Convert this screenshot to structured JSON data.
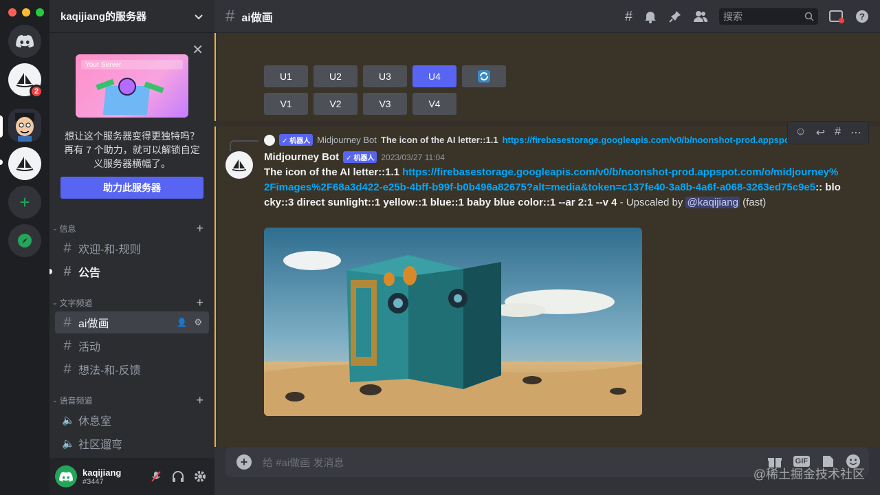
{
  "window": {
    "traffic_colors": [
      "#ff5f57",
      "#febc2e",
      "#28c840"
    ]
  },
  "rail": {
    "unread_badge": "2"
  },
  "sidebar": {
    "server_name": "kaqijiang的服务器",
    "promo": {
      "image_label": "Your Server",
      "text": "想让这个服务器变得更独特吗？再有 7 个助力，就可以解锁自定义服务器横幅了。",
      "button": "助力此服务器"
    },
    "categories": [
      {
        "label": "信息",
        "channels": [
          {
            "name": "欢迎-和-规则"
          },
          {
            "name": "公告"
          }
        ]
      },
      {
        "label": "文字频道",
        "channels": [
          {
            "name": "ai做画"
          },
          {
            "name": "活动"
          },
          {
            "name": "想法-和-反馈"
          }
        ]
      },
      {
        "label": "语音频道",
        "channels": [
          {
            "name": "休息室"
          },
          {
            "name": "社区遛弯"
          }
        ]
      }
    ]
  },
  "user": {
    "name": "kaqijiang",
    "tag": "#3447"
  },
  "header": {
    "channel": "ai做画",
    "search_placeholder": "搜索"
  },
  "message_prev": {
    "row1": [
      "U1",
      "U2",
      "U3",
      "U4"
    ],
    "row2": [
      "V1",
      "V2",
      "V3",
      "V4"
    ]
  },
  "message": {
    "reply_author": "Midjourney Bot",
    "reply_text": "The icon of the AI letter::1.1",
    "reply_link": "https://firebasestorage.googleapis.com/v0/b/noonshot-prod.appspot.com/",
    "bot_tag": "✓ 机器人",
    "author": "Midjourney Bot",
    "timestamp": "2023/03/27 11:04",
    "prompt": "The icon of the AI letter::1.1",
    "link": "https://firebasestorage.googleapis.com/v0/b/noonshot-prod.appspot.com/o/midjourney%2Fimages%2F68a3d422-e25b-4bff-b99f-b0b496a82675?alt=media&token=c137fe40-3a8b-4a6f-a068-3263ed75c9e5",
    "params": ":: blocky::3 direct sunlight::1 yellow::1 blue::1 baby blue color::1 --ar 2:1 --v 4",
    "upscaled_by": " - Upscaled by ",
    "mention": "@kaqijiang",
    "suffix": " (fast)"
  },
  "composer": {
    "placeholder": "给 #ai做画 发消息",
    "gif": "GIF"
  },
  "watermark": "@稀土掘金技术社区"
}
